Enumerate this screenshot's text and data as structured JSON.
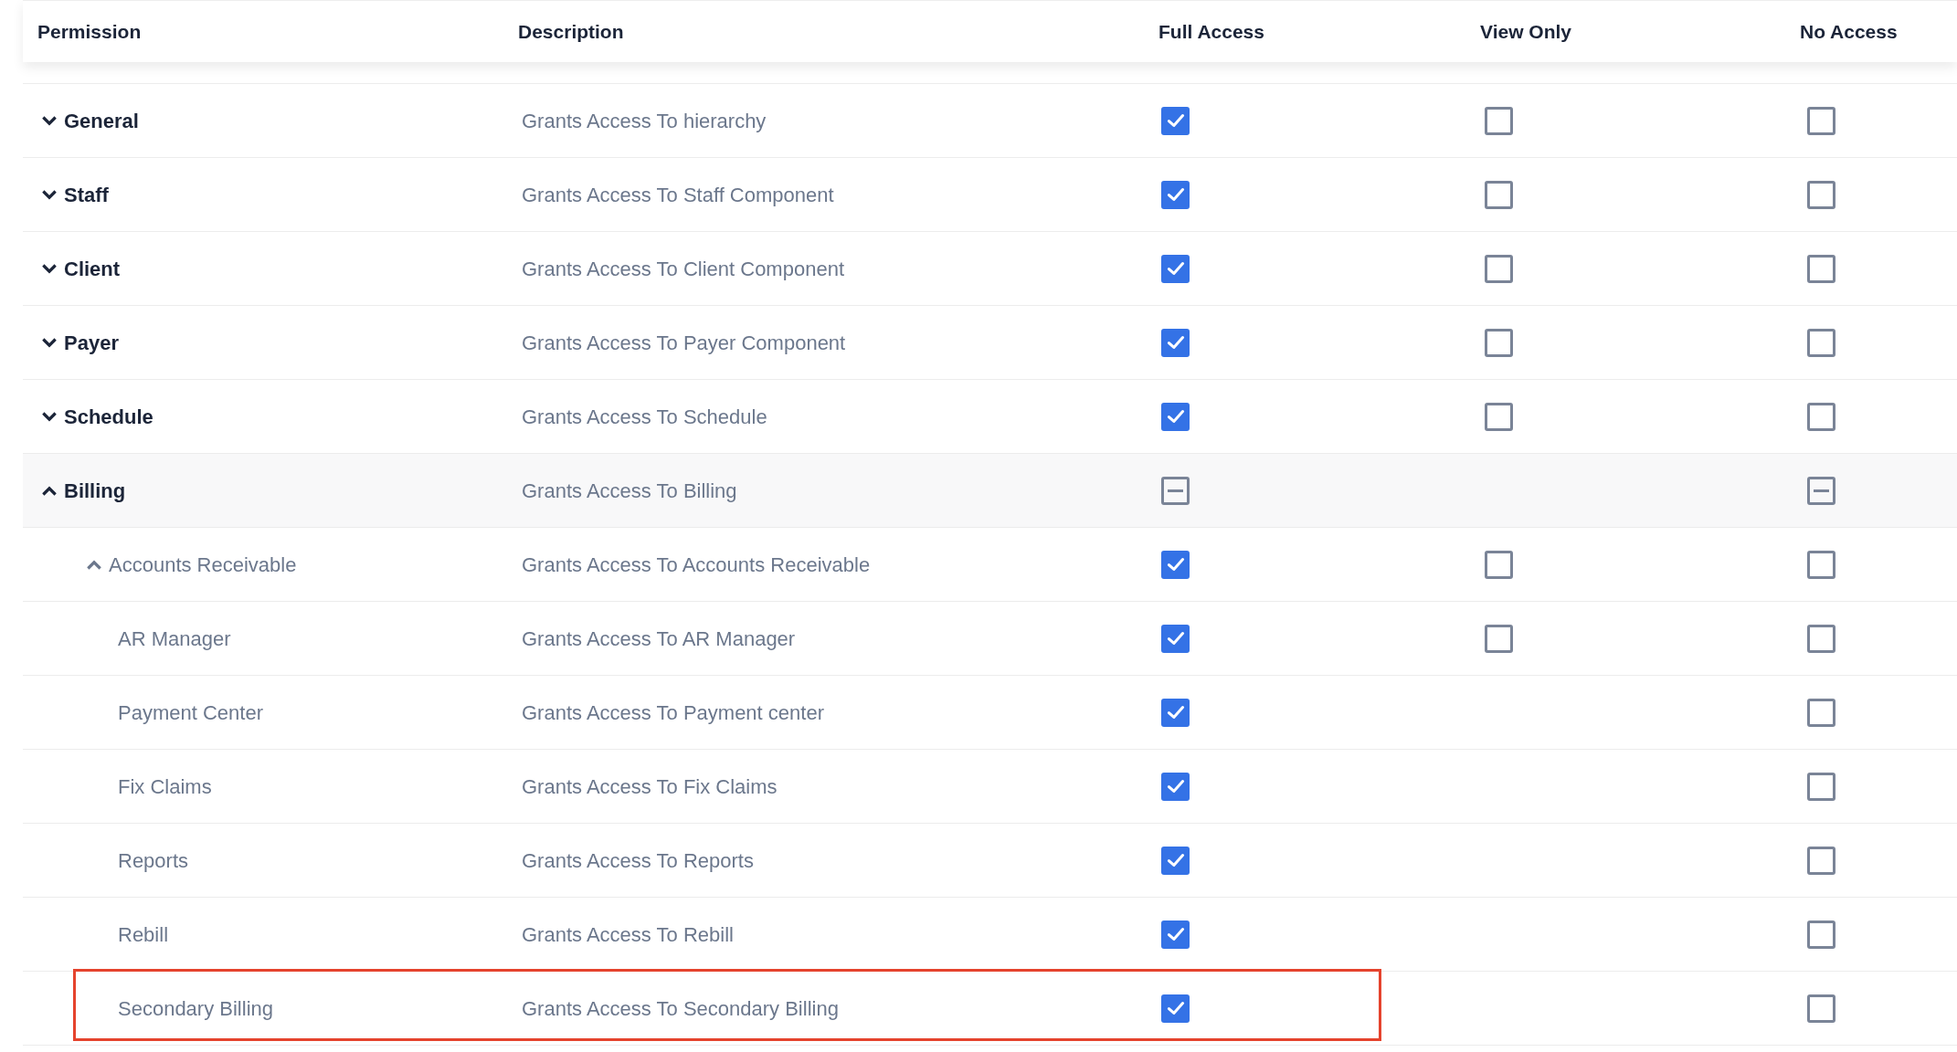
{
  "columns": [
    "Permission",
    "Description",
    "Full Access",
    "View Only",
    "No Access"
  ],
  "rows": [
    {
      "label": "General",
      "description": "Grants Access To hierarchy",
      "expanded": false,
      "full": {
        "checked": true
      },
      "view": {
        "checked": false
      },
      "none": {
        "checked": false
      }
    },
    {
      "label": "Staff",
      "description": "Grants Access To Staff Component",
      "expanded": false,
      "full": {
        "checked": true
      },
      "view": {
        "checked": false
      },
      "none": {
        "checked": false
      }
    },
    {
      "label": "Client",
      "description": "Grants Access To Client Component",
      "expanded": false,
      "full": {
        "checked": true
      },
      "view": {
        "checked": false
      },
      "none": {
        "checked": false
      }
    },
    {
      "label": "Payer",
      "description": "Grants Access To Payer Component",
      "expanded": false,
      "full": {
        "checked": true
      },
      "view": {
        "checked": false
      },
      "none": {
        "checked": false
      }
    },
    {
      "label": "Schedule",
      "description": "Grants Access To Schedule",
      "expanded": false,
      "full": {
        "checked": true
      },
      "view": {
        "checked": false
      },
      "none": {
        "checked": false
      }
    },
    {
      "label": "Billing",
      "description": "Grants Access To Billing",
      "expanded": true,
      "full": {
        "indeterminate": true
      },
      "none": {
        "indeterminate": true
      },
      "children": [
        {
          "label": "Accounts Receivable",
          "description": "Grants Access To Accounts Receivable",
          "expanded": true,
          "full": {
            "checked": true
          },
          "view": {
            "checked": false
          },
          "none": {
            "checked": false
          },
          "children": [
            {
              "label": "AR Manager",
              "description": "Grants Access To AR Manager",
              "full": {
                "checked": true
              },
              "view": {
                "checked": false
              },
              "none": {
                "checked": false
              }
            },
            {
              "label": "Payment Center",
              "description": "Grants Access To Payment center",
              "full": {
                "checked": true
              },
              "none": {
                "checked": false
              }
            },
            {
              "label": "Fix Claims",
              "description": "Grants Access To Fix Claims",
              "full": {
                "checked": true
              },
              "none": {
                "checked": false
              }
            },
            {
              "label": "Reports",
              "description": "Grants Access To Reports",
              "full": {
                "checked": true
              },
              "none": {
                "checked": false
              }
            },
            {
              "label": "Rebill",
              "description": "Grants Access To Rebill",
              "full": {
                "checked": true
              },
              "none": {
                "checked": false
              }
            },
            {
              "label": "Secondary Billing",
              "description": "Grants Access To Secondary Billing",
              "full": {
                "checked": true
              },
              "none": {
                "checked": false
              },
              "highlighted": true
            }
          ]
        }
      ]
    }
  ]
}
